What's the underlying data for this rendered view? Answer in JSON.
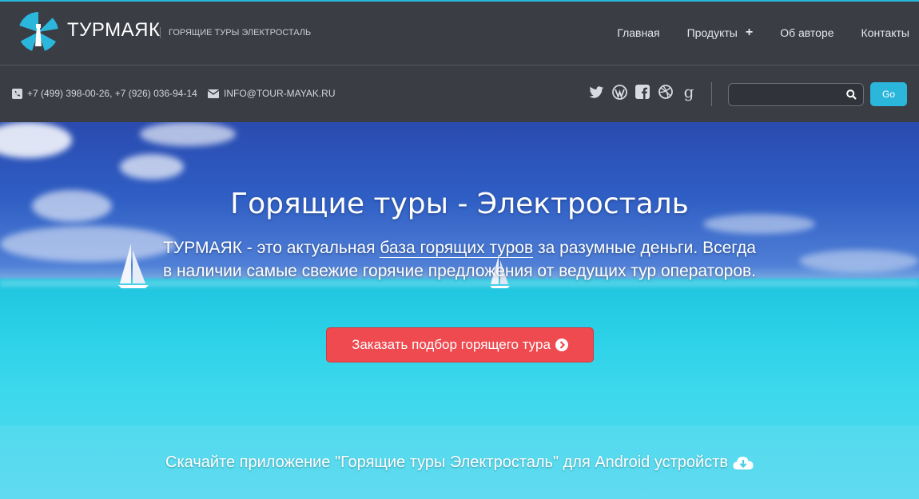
{
  "header": {
    "brand": "ТУРМАЯК",
    "tagline": "ГОРЯЩИЕ ТУРЫ ЭЛЕКТРОСТАЛЬ",
    "nav": [
      {
        "label": "Главная"
      },
      {
        "label": "Продукты",
        "expand": "+"
      },
      {
        "label": "Об авторе"
      },
      {
        "label": "Контакты"
      }
    ]
  },
  "subbar": {
    "phone": "+7 (499) 398-00-26, +7 (926) 036-94-14",
    "email": "INFO@TOUR-MAYAK.RU",
    "social_icons": [
      "twitter-icon",
      "wordpress-icon",
      "facebook-icon",
      "dribbble-icon",
      "google-icon"
    ],
    "search_value": "",
    "go_label": "Go"
  },
  "hero": {
    "title": "Горящие туры - Электросталь",
    "text_before": "ТУРМАЯК - это актуальная ",
    "text_link": "база горящих туров",
    "text_after": " за разумные деньги. Всегда в наличии самые свежие горячие предложения от ведущих тур операторов.",
    "cta_label": "Заказать подбор горящего тура",
    "app_text": "Скачайте приложение \"Горящие туры Электросталь\" для Android устройств"
  },
  "colors": {
    "header_bg": "#3a3d44",
    "accent": "#2bb6dc",
    "cta": "#ef4a4f"
  }
}
